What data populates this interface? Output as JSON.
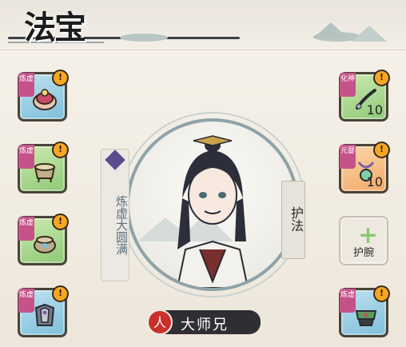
{
  "header": {
    "title": "法宝"
  },
  "left_slots": [
    {
      "tag": "炼虚",
      "color": "blue",
      "alert": "!",
      "item_icon": "ring-treasure-icon"
    },
    {
      "tag": "炼虚",
      "color": "green",
      "alert": "!",
      "item_icon": "cauldron-icon"
    },
    {
      "tag": "炼虚",
      "color": "green",
      "alert": "!",
      "item_icon": "incense-burner-icon"
    },
    {
      "tag": "炼虚",
      "color": "blue",
      "alert": "!",
      "item_icon": "armor-icon"
    }
  ],
  "right_slots": [
    {
      "tag": "化神",
      "color": "green",
      "alert": "!",
      "count": "10",
      "item_icon": "whip-icon"
    },
    {
      "tag": "元婴",
      "color": "orange",
      "alert": "!",
      "count": "10",
      "item_icon": "pendant-icon"
    },
    {
      "label": "护腕",
      "empty": true,
      "item_icon": "plus-icon"
    },
    {
      "tag": "炼虚",
      "color": "blue",
      "alert": "!",
      "item_icon": "bracer-icon"
    }
  ],
  "character": {
    "rank": "炼虚大圆满",
    "role_tab": "护法",
    "name": "大师兄",
    "type_glyph": "人"
  },
  "colors": {
    "tag": "#c6528a",
    "alert": "#f5a623",
    "name_bar": "#2f2f33",
    "type_icon": "#c9302c"
  }
}
